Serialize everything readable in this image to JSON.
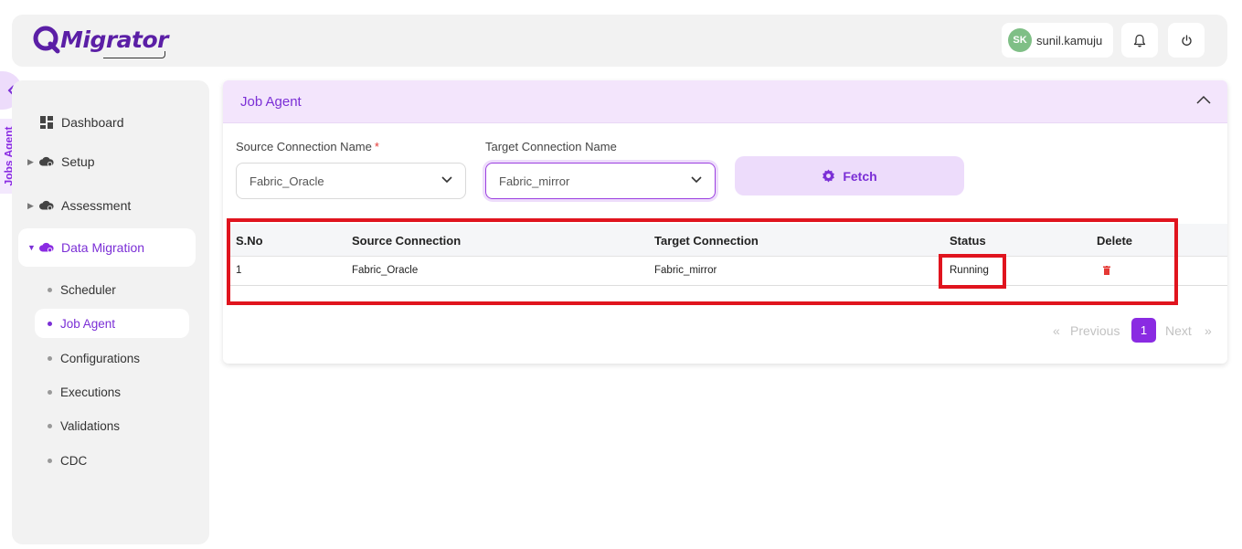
{
  "header": {
    "brand": "Migrator",
    "user": {
      "initials": "SK",
      "name": "sunil.kamuju"
    },
    "icons": [
      "bell-icon",
      "power-icon"
    ]
  },
  "side_tab": {
    "label": "Jobs Agent"
  },
  "sidebar": {
    "items": [
      {
        "label": "Dashboard",
        "icon": "dashboard-icon"
      },
      {
        "label": "Setup",
        "icon": "cloud-gear-icon"
      },
      {
        "label": "Assessment",
        "icon": "cloud-gear-icon"
      },
      {
        "label": "Data Migration",
        "icon": "cloud-gear-icon"
      }
    ],
    "subitems": [
      {
        "label": "Scheduler"
      },
      {
        "label": "Job Agent"
      },
      {
        "label": "Configurations"
      },
      {
        "label": "Executions"
      },
      {
        "label": "Validations"
      },
      {
        "label": "CDC"
      }
    ]
  },
  "card": {
    "title": "Job Agent",
    "source_label": "Source Connection Name",
    "required_mark": "*",
    "source_value": "Fabric_Oracle",
    "target_label": "Target Connection Name",
    "target_value": "Fabric_mirror",
    "fetch_label": "Fetch"
  },
  "table": {
    "columns": [
      "S.No",
      "Source Connection",
      "Target Connection",
      "Status",
      "Delete"
    ],
    "rows": [
      {
        "sno": "1",
        "source": "Fabric_Oracle",
        "target": "Fabric_mirror",
        "status": "Running"
      }
    ]
  },
  "pagination": {
    "first": "«",
    "previous": "Previous",
    "current": "1",
    "next": "Next",
    "last": "»"
  },
  "colors": {
    "accent": "#8a2be2",
    "accent_light": "#eddcfb",
    "highlight": "#e0141e",
    "delete": "#e53935"
  }
}
